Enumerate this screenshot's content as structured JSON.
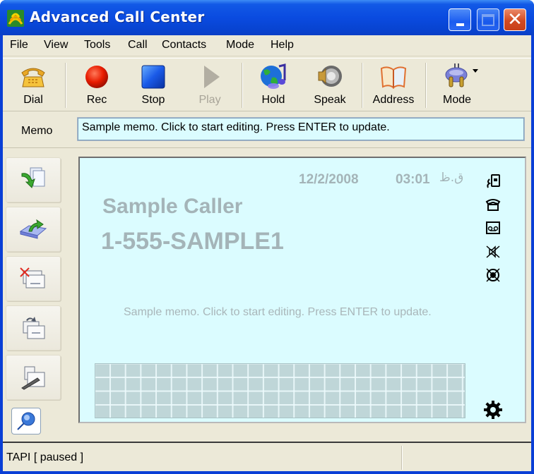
{
  "window": {
    "title": "Advanced Call Center",
    "controls": {
      "minimize": "minimize",
      "maximize": "maximize",
      "close": "close"
    }
  },
  "menu": [
    "File",
    "View",
    "Tools",
    "Call",
    "Contacts",
    "Mode",
    "Help"
  ],
  "toolbar": {
    "buttons": [
      {
        "label": "Dial",
        "icon": "telephone-icon",
        "enabled": true
      },
      {
        "label": "Rec",
        "icon": "record-icon",
        "enabled": true
      },
      {
        "label": "Stop",
        "icon": "stop-icon",
        "enabled": true
      },
      {
        "label": "Play",
        "icon": "play-icon",
        "enabled": false
      },
      {
        "label": "Hold",
        "icon": "hold-globe-music-icon",
        "enabled": true
      },
      {
        "label": "Speak",
        "icon": "speaker-icon",
        "enabled": true
      },
      {
        "label": "Address",
        "icon": "address-book-icon",
        "enabled": true
      },
      {
        "label": "Mode",
        "icon": "plug-icon",
        "enabled": true,
        "has_dropdown": true
      }
    ]
  },
  "memo": {
    "label": "Memo",
    "value": "Sample memo. Click to start editing. Press ENTER to update."
  },
  "sidebar": {
    "buttons": [
      {
        "name": "incoming-calls",
        "icon": "document-arrow-down-icon"
      },
      {
        "name": "outgoing-calls",
        "icon": "tray-arrow-out-icon"
      },
      {
        "name": "missed-calls",
        "icon": "envelope-x-icon"
      },
      {
        "name": "forwarded-messages",
        "icon": "envelopes-forward-icon"
      },
      {
        "name": "notes",
        "icon": "document-pen-icon"
      }
    ],
    "small_button": {
      "name": "pin",
      "icon": "pushpin-icon"
    }
  },
  "display": {
    "date": "12/2/2008",
    "time": "03:01",
    "ampm": "ق.ظ",
    "caller_name": "Sample Caller",
    "caller_number": "1-555-SAMPLE1",
    "memo": "Sample memo. Click to start editing. Press ENTER to update.",
    "status_icons": [
      "caller-id-icon",
      "phone-icon",
      "answering-machine-icon",
      "speaker-muted-icon",
      "recording-off-icon"
    ],
    "settings_icon": "gear-icon"
  },
  "statusbar": {
    "text": "TAPI [ paused ]",
    "secondary": ""
  },
  "colors": {
    "titlebar": "#0a4be0",
    "display_bg": "#dbfcff",
    "display_text": "#a4b4b8",
    "chrome": "#ece9d8"
  }
}
